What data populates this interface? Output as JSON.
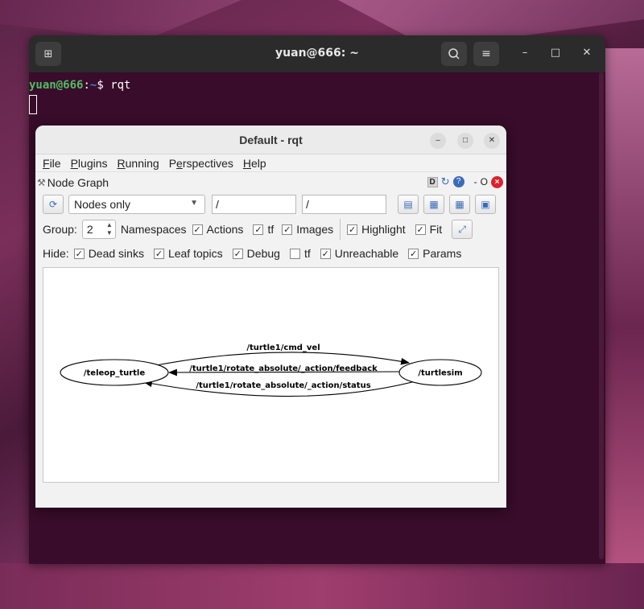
{
  "terminal": {
    "title": "yuan@666: ~",
    "prompt_user": "yuan@666",
    "prompt_sep": ":",
    "prompt_path": "~",
    "prompt_symbol": "$",
    "command": "rqt"
  },
  "rqt": {
    "title": "Default - rqt",
    "menu": [
      {
        "mnemonic": "F",
        "rest": "ile"
      },
      {
        "mnemonic": "P",
        "rest": "lugins"
      },
      {
        "mnemonic": "R",
        "rest": "unning"
      },
      {
        "pre": "P",
        "mnemonic": "e",
        "rest": "rspectives"
      },
      {
        "mnemonic": "H",
        "rest": "elp"
      }
    ],
    "plugin": {
      "title": "Node Graph",
      "badge_d": "D",
      "dash": "-",
      "o": "O"
    },
    "toolbar": {
      "nodes_combo": "Nodes only",
      "filter1": "/",
      "filter2": "/"
    },
    "group_row": {
      "group_label": "Group:",
      "group_value": "2",
      "namespaces": "Namespaces",
      "actions": "Actions",
      "tf": "tf",
      "images": "Images",
      "highlight": "Highlight",
      "fit": "Fit"
    },
    "hide_row": {
      "hide_label": "Hide:",
      "dead_sinks": "Dead sinks",
      "leaf_topics": "Leaf topics",
      "debug": "Debug",
      "tf": "tf",
      "unreachable": "Unreachable",
      "params": "Params"
    },
    "checks": {
      "namespaces": true,
      "actions": true,
      "tf": true,
      "images": true,
      "highlight": true,
      "fit": true,
      "dead_sinks": true,
      "leaf_topics": true,
      "debug": true,
      "tf_hide": false,
      "unreachable": true,
      "params": true
    },
    "graph": {
      "nodes": [
        "/teleop_turtle",
        "/turtlesim"
      ],
      "edges": [
        "/turtle1/cmd_vel",
        "/turtle1/rotate_absolute/_action/feedback",
        "/turtle1/rotate_absolute/_action/status"
      ]
    }
  }
}
